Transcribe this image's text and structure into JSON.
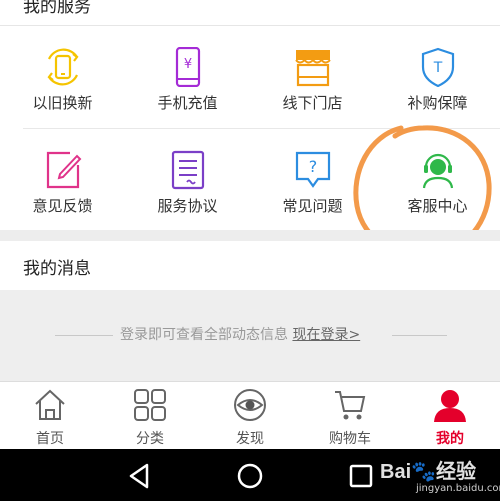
{
  "services": {
    "title": "我的服务",
    "items": [
      {
        "label": "以旧换新",
        "icon": "phone-exchange-icon",
        "color": "#f5c400"
      },
      {
        "label": "手机充值",
        "icon": "phone-recharge-icon",
        "color": "#a42bd6"
      },
      {
        "label": "线下门店",
        "icon": "store-icon",
        "color": "#f39c12"
      },
      {
        "label": "补购保障",
        "icon": "shield-icon",
        "color": "#2c8de0"
      },
      {
        "label": "意见反馈",
        "icon": "feedback-edit-icon",
        "color": "#e0338a"
      },
      {
        "label": "服务协议",
        "icon": "agreement-document-icon",
        "color": "#7b3fc7"
      },
      {
        "label": "常见问题",
        "icon": "faq-question-icon",
        "color": "#2c8de0"
      },
      {
        "label": "客服中心",
        "icon": "customer-service-headset-icon",
        "color": "#2fb84a"
      }
    ]
  },
  "messages": {
    "title": "我的消息",
    "notice": "登录即可查看全部动态信息",
    "login_link": "现在登录>"
  },
  "tabbar": {
    "active_color": "#e4002b",
    "items": [
      {
        "label": "首页",
        "icon": "home-icon"
      },
      {
        "label": "分类",
        "icon": "category-grid-icon"
      },
      {
        "label": "发现",
        "icon": "discover-eye-icon"
      },
      {
        "label": "购物车",
        "icon": "shopping-cart-icon"
      },
      {
        "label": "我的",
        "icon": "user-profile-icon",
        "active": true
      }
    ]
  },
  "annotation_color": "#f39a4a",
  "watermark": {
    "logo": "Bai🐾经验",
    "url": "jingyan.baidu.com"
  }
}
